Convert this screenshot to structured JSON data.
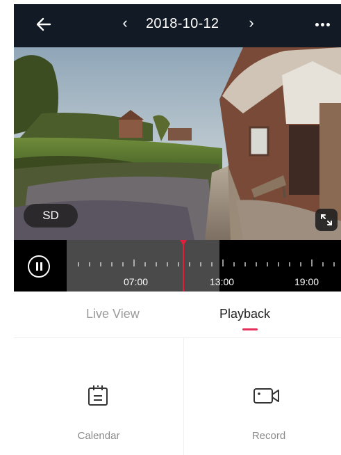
{
  "header": {
    "back_icon": "arrow-left-icon",
    "prev_icon": "chevron-left-icon",
    "next_icon": "chevron-right-icon",
    "prev_glyph": "‹",
    "next_glyph": "›",
    "date": "2018-10-12",
    "more_icon": "more-dots-icon"
  },
  "video": {
    "quality_label": "SD",
    "fullscreen_icon": "fullscreen-icon"
  },
  "timeline": {
    "pause_icon": "pause-icon",
    "labels": [
      "07:00",
      "13:00",
      "19:00"
    ]
  },
  "tabs": {
    "live_view": "Live View",
    "playback": "Playback",
    "active": "Playback",
    "accent_color": "#e7305b"
  },
  "actions": {
    "calendar": "Calendar",
    "calendar_icon": "calendar-icon",
    "record": "Record",
    "record_icon": "video-camera-icon"
  }
}
